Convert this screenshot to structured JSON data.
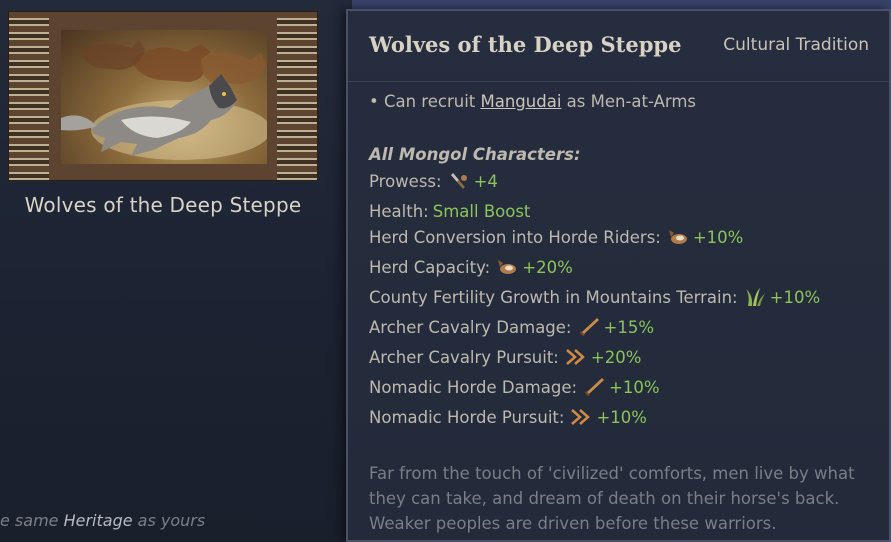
{
  "card": {
    "title": "Wolves of the Deep Steppe",
    "art_icon": "wolf-and-horses-illustration",
    "heritage_prefix": "e same ",
    "heritage_word": "Heritage",
    "heritage_suffix": " as yours"
  },
  "tooltip": {
    "title": "Wolves of the Deep Steppe",
    "type": "Cultural Tradition",
    "bullet_prefix": "• Can recruit ",
    "bullet_link": "Mangudai",
    "bullet_suffix": " as Men-at-Arms",
    "section_title": "All Mongol Characters:",
    "modifiers": [
      {
        "label": "Prowess:",
        "icon": "prowess-icon",
        "value": "+4"
      },
      {
        "label": "Health:",
        "icon": "",
        "value": "Small Boost"
      },
      {
        "label": "Herd Conversion into Horde Riders:",
        "icon": "herd-icon",
        "value": "+10%"
      },
      {
        "label": "Herd Capacity:",
        "icon": "herd-icon",
        "value": "+20%"
      },
      {
        "label": "County Fertility Growth in Mountains Terrain:",
        "icon": "grass-icon",
        "value": "+10%"
      },
      {
        "label": "Archer Cavalry Damage:",
        "icon": "sword-icon",
        "value": "+15%"
      },
      {
        "label": "Archer Cavalry Pursuit:",
        "icon": "pursuit-icon",
        "value": "+20%"
      },
      {
        "label": "Nomadic Horde Damage:",
        "icon": "sword-icon",
        "value": "+10%"
      },
      {
        "label": "Nomadic Horde Pursuit:",
        "icon": "pursuit-icon",
        "value": "+10%"
      }
    ],
    "flavor": "Far from the touch of 'civilized' comforts, men live by what they can take, and dream of death on their horse's back. Weaker peoples are driven before these warriors."
  },
  "colors": {
    "positive": "#8cc45b",
    "text": "#bdb9ae",
    "muted": "#7b7e86"
  }
}
